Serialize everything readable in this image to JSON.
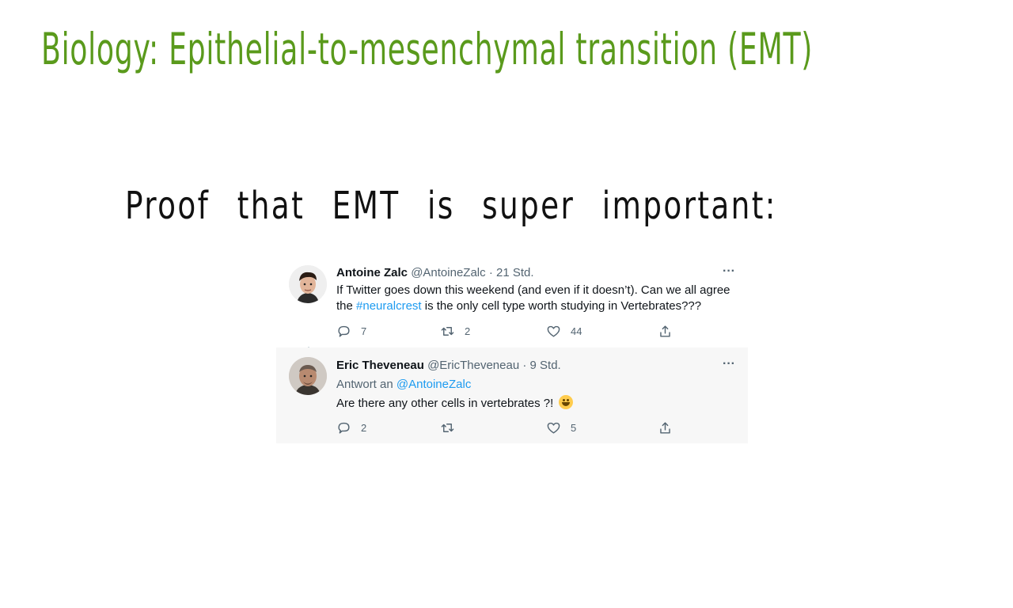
{
  "heading": "Biology: Epithelial-to-mesenchymal  transition (EMT)",
  "subheading": "Proof that EMT is super important:",
  "tweets": [
    {
      "name": "Antoine Zalc",
      "handle": "@AntoineZalc",
      "time": "21 Std.",
      "text_before": "If Twitter goes down this weekend (and even if it doesn’t). Can we all agree the ",
      "hashtag": "#neuralcrest",
      "text_after": " is the only cell type worth studying in Vertebrates???",
      "replies": "7",
      "retweets": "2",
      "likes": "44"
    },
    {
      "name": "Eric Theveneau",
      "handle": "@EricTheveneau",
      "time": "9 Std.",
      "replying_label": "Antwort an ",
      "replying_to": "@AntoineZalc",
      "text": "Are there any other cells in vertebrates ?! ",
      "emoji": "grinning-face-emoji",
      "replies": "2",
      "retweets": "",
      "likes": "5"
    }
  ],
  "more_label": "···",
  "colors": {
    "heading": "#5a9a1c",
    "link": "#1d9bf0",
    "reply_background": "#f7f7f7"
  }
}
